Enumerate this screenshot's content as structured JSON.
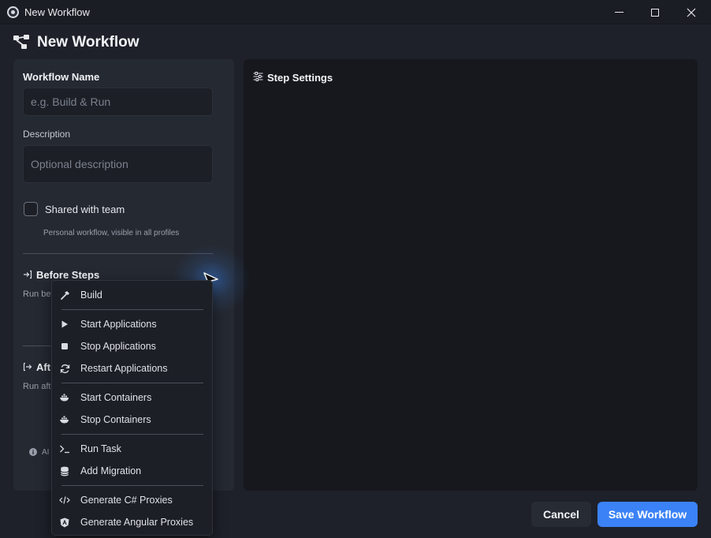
{
  "window": {
    "title": "New Workflow",
    "controls": {
      "minimize": "minimize",
      "maximize": "maximize",
      "close": "close"
    }
  },
  "header": {
    "title": "New Workflow",
    "icon": "workflow-icon"
  },
  "form": {
    "name_label": "Workflow Name",
    "name_placeholder": "e.g. Build & Run",
    "description_label": "Description",
    "description_placeholder": "Optional description",
    "shared_label": "Shared with team",
    "shared_checked": false,
    "shared_hint": "Personal workflow, visible in all profiles",
    "before_steps_title": "Before Steps",
    "before_steps_hint": "Run bef",
    "after_steps_title": "Aft",
    "after_steps_hint": "Run afte",
    "ai_note": "AI"
  },
  "step_settings": {
    "title": "Step Settings"
  },
  "footer": {
    "cancel_label": "Cancel",
    "save_label": "Save Workflow"
  },
  "menu": {
    "items": [
      {
        "label": "Build",
        "icon": "hammer-icon"
      },
      {
        "label": "Start Applications",
        "icon": "play-icon"
      },
      {
        "label": "Stop Applications",
        "icon": "stop-icon"
      },
      {
        "label": "Restart Applications",
        "icon": "refresh-icon"
      },
      {
        "label": "Start Containers",
        "icon": "docker-icon"
      },
      {
        "label": "Stop Containers",
        "icon": "docker-icon"
      },
      {
        "label": "Run Task",
        "icon": "terminal-icon"
      },
      {
        "label": "Add Migration",
        "icon": "database-icon"
      },
      {
        "label": "Generate C# Proxies",
        "icon": "code-icon"
      },
      {
        "label": "Generate Angular Proxies",
        "icon": "angular-icon"
      }
    ]
  },
  "colors": {
    "accent": "#3b82f6",
    "background": "#1e2129",
    "panel": "#252932",
    "panel_dark": "#16181d"
  }
}
